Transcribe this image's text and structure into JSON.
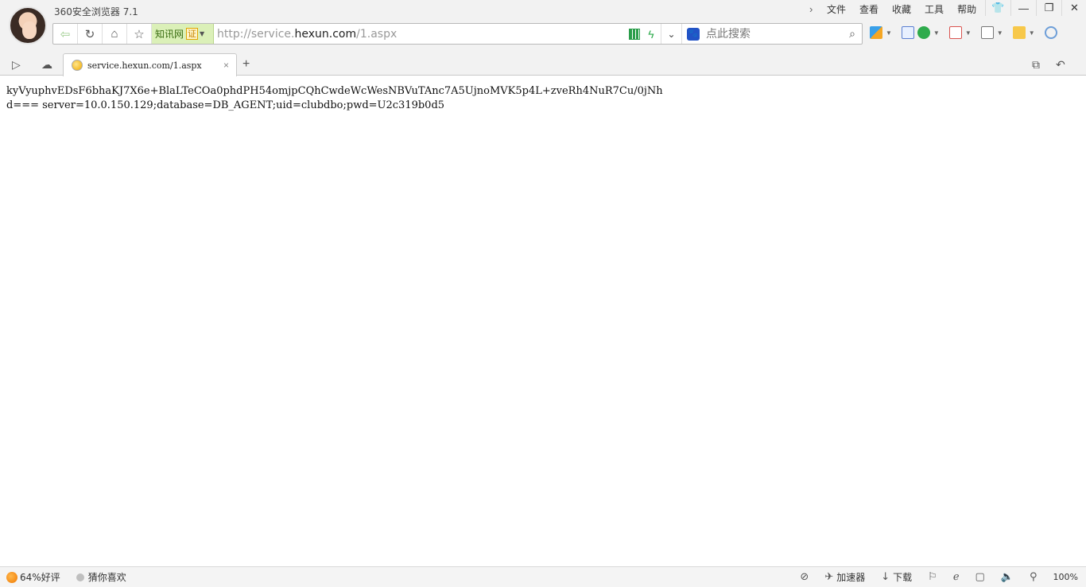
{
  "app": {
    "title": "360安全浏览器 7.1"
  },
  "menu": {
    "items": [
      "文件",
      "查看",
      "收藏",
      "工具",
      "帮助"
    ]
  },
  "window_buttons": {
    "skin": "👕",
    "minimize": "—",
    "restore": "❐",
    "close": "✕"
  },
  "nav": {
    "cert_label": "知讯网",
    "cert_badge": "证",
    "url_prefix": "http://service.",
    "url_host": "hexun.com",
    "url_path": "/1.aspx",
    "search_placeholder": "点此搜索"
  },
  "tab": {
    "title": "service.hexun.com/1.aspx",
    "close": "×",
    "new": "+"
  },
  "content": {
    "line1": "kyVyuphvEDsF6bhaKJ7X6e+BlaLTeCOa0phdPH54omjpCQhCwdeWcWesNBVuTAnc7A5UjnoMVK5p4L+zveRh4NuR7Cu/0jNh",
    "line2": "d=== server=10.0.150.129;database=DB_AGENT;uid=clubdbo;pwd=U2c319b0d5"
  },
  "status": {
    "rating": "64%好评",
    "guess": "猜你喜欢",
    "accelerator": "加速器",
    "download": "下载",
    "zoom": "100%"
  },
  "colors": {
    "cert_bg": "#dbf0b8",
    "accent": "#2eab4c"
  }
}
